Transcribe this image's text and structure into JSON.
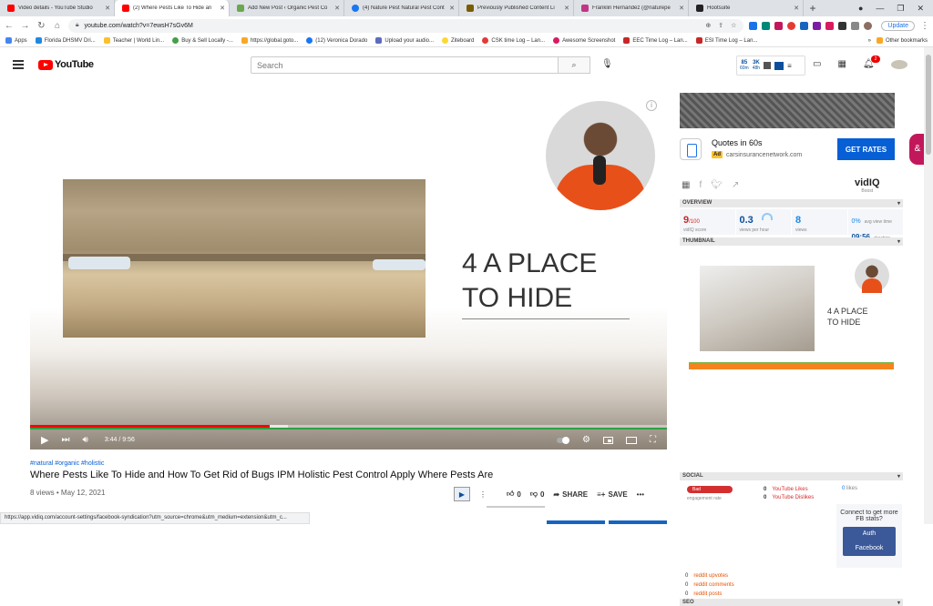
{
  "browser": {
    "tabs": [
      {
        "title": "Video details - YouTube Studio",
        "color": "#ff0000",
        "active": false
      },
      {
        "title": "(2) Where Pests Like To Hide an",
        "color": "#ff0000",
        "active": true
      },
      {
        "title": "Add New Post ‹ Organic Pest Co",
        "color": "#6aa84f",
        "active": false
      },
      {
        "title": "(4) Nature Pest Natural Pest Cont",
        "color": "#1877f2",
        "active": false
      },
      {
        "title": "Previously Published Content Li",
        "color": "#7a5c00",
        "active": false
      },
      {
        "title": "Franklin Hernandez (@naturepe",
        "color": "#c13584",
        "active": false
      },
      {
        "title": "Hootsuite",
        "color": "#222222",
        "active": false
      }
    ],
    "url": "youtube.com/watch?v=7ewsH7sGv6M",
    "update_label": "Update",
    "bookmarks": [
      {
        "label": "Apps",
        "color": "#4285f4"
      },
      {
        "label": "Florida DHSMV Dri...",
        "color": "#1e88e5"
      },
      {
        "label": "Teacher | World Lin...",
        "color": "#fbc02d"
      },
      {
        "label": "Buy & Sell Locally -...",
        "color": "#43a047"
      },
      {
        "label": "https://global.goto...",
        "color": "#f9a825"
      },
      {
        "label": "(12) Veronica Dorado",
        "color": "#1877f2"
      },
      {
        "label": "Upload your audio...",
        "color": "#5c6bc0"
      },
      {
        "label": "Ziteboard",
        "color": "#fdd835"
      },
      {
        "label": "CSK time Log – Lan...",
        "color": "#e53935"
      },
      {
        "label": "Awesome Screenshot",
        "color": "#d81b60"
      },
      {
        "label": "EEC Time Log – Lan...",
        "color": "#c62828"
      },
      {
        "label": "ESI Time Log – Lan...",
        "color": "#c62828"
      }
    ],
    "other_bookmarks": "Other bookmarks"
  },
  "youtube": {
    "logo_text": "YouTube",
    "search_placeholder": "Search",
    "notification_count": "2",
    "vidiq_stats": [
      {
        "value": "85",
        "label": "60m"
      },
      {
        "value": "3K",
        "label": "48h"
      }
    ]
  },
  "video": {
    "slide_title_line1": "4 A PLACE",
    "slide_title_line2": "TO HIDE",
    "current_time": "3:44 / 9:56",
    "progress_fraction": 0.376,
    "buffered_fraction": 0.405,
    "tags": "#natural #organic #holistic",
    "title": "Where Pests Like To Hide and How To Get Rid of Bugs IPM Holistic Pest Control Apply Where Pests Are",
    "meta": "8 views • May 12, 2021",
    "likes": "0",
    "dislikes": "0",
    "share_label": "SHARE",
    "save_label": "SAVE"
  },
  "ad": {
    "title": "Quotes in 60s",
    "badge": "Ad",
    "domain": "carsinsurancenetwork.com",
    "cta": "GET RATES"
  },
  "vidiq": {
    "logo": "vidIQ",
    "logo_sub": "Boost",
    "overview_label": "OVERVIEW",
    "score": "9",
    "score_suffix": "/100",
    "score_label": "vidIQ score",
    "views_per_hour": "0.3",
    "views_per_hour_label": "views per hour",
    "views": "8",
    "views_label": "views",
    "pct": "0%",
    "duration": "09:56",
    "avg_label": "avg view time",
    "duration_label": "duration",
    "thumbnail_label": "THUMBNAIL",
    "social_label": "SOCIAL",
    "eng_pill": "Bad",
    "eng_label": "engagement rate",
    "yt_likes": "0",
    "yt_likes_label": "YouTube Likes",
    "yt_dislikes": "0",
    "yt_dislikes_label": "YouTube Dislikes",
    "fb_likes": "0",
    "fb_likes_label": "likes",
    "fb_prompt": "Connect to get more FB stats?",
    "fb_btn_line1": "Auth",
    "fb_btn_line2": "Facebook",
    "reddit_upvotes": "0",
    "reddit_upvotes_label": "reddit upvotes",
    "reddit_comments": "0",
    "reddit_comments_label": "reddit comments",
    "reddit_posts": "0",
    "reddit_posts_label": "reddit posts",
    "seo_label": "SEO"
  },
  "status_url": "https://app.vidiq.com/account-settings/facebook-syndication?utm_source=chrome&utm_medium=extension&utm_c..."
}
